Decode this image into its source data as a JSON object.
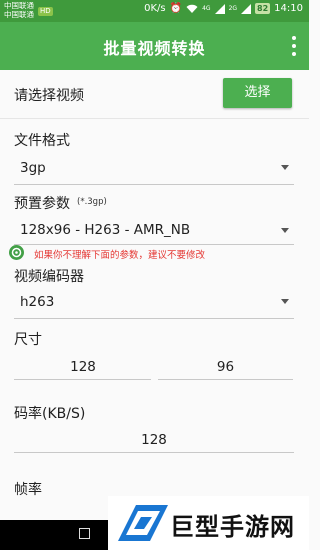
{
  "status_bar": {
    "carrier_line1": "中国联通",
    "carrier_line2": "中国联通",
    "carrier_badge": "HD",
    "speed": "0K/s",
    "signal1": "4G",
    "signal2": "2G",
    "battery": "82",
    "time": "14:10"
  },
  "app_bar": {
    "title": "批量视频转换"
  },
  "video_select": {
    "label": "请选择视频",
    "button": "选择"
  },
  "file_format": {
    "label": "文件格式",
    "value": "3gp"
  },
  "preset": {
    "label": "预置参数",
    "hint": "(*.3gp)",
    "value": "128x96 - H263 - AMR_NB"
  },
  "warning": "如果你不理解下面的参数，建议不要修改",
  "video_codec": {
    "label": "视频编码器",
    "value": "h263"
  },
  "size": {
    "label": "尺寸",
    "width": "128",
    "height": "96"
  },
  "bitrate": {
    "label": "码率(KB/S)",
    "value": "128"
  },
  "framerate": {
    "label": "帧率"
  },
  "watermark": {
    "text": "巨型手游网"
  },
  "colors": {
    "primary": "#4caf50",
    "status_bar": "#3f9a3c",
    "warning": "#e53935"
  }
}
